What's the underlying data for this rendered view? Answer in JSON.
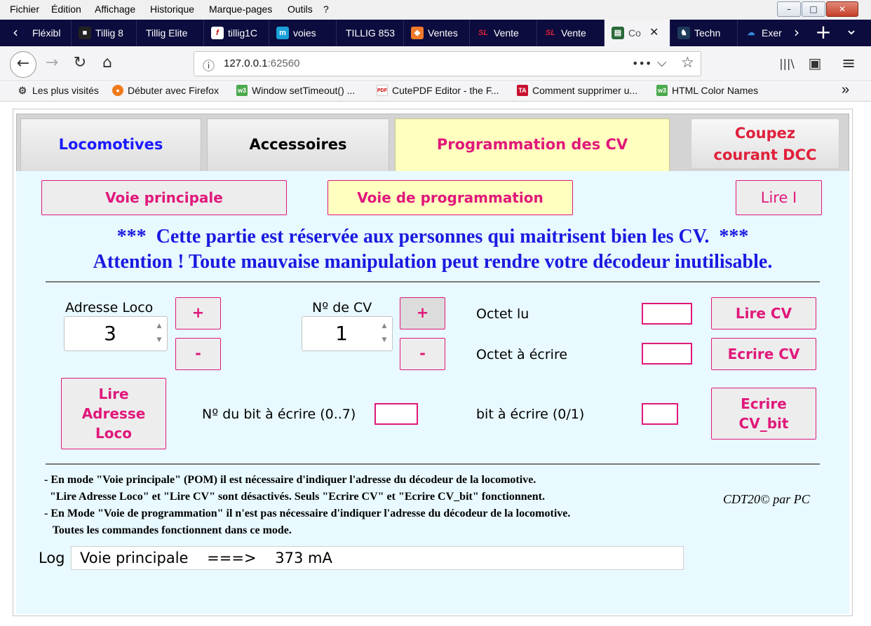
{
  "menubar": {
    "items": [
      {
        "label": "Fichier"
      },
      {
        "label": "Édition"
      },
      {
        "label": "Affichage"
      },
      {
        "label": "Historique"
      },
      {
        "label": "Marque-pages"
      },
      {
        "label": "Outils"
      },
      {
        "label": "?"
      }
    ]
  },
  "window_controls": {
    "minimize": "–",
    "maximize": "□",
    "close": "✕"
  },
  "tabs": [
    {
      "label": "Fléxibl",
      "icon": "none"
    },
    {
      "label": "Tillig 8",
      "icon": "site-icon"
    },
    {
      "label": "Tillig Elite",
      "icon": "none"
    },
    {
      "label": "tillig1C",
      "icon": "f-icon"
    },
    {
      "label": "voies",
      "icon": "m-icon"
    },
    {
      "label": "TILLIG 853",
      "icon": "none"
    },
    {
      "label": "Ventes",
      "icon": "box-icon"
    },
    {
      "label": "Vente",
      "icon": "sl-icon"
    },
    {
      "label": "Vente",
      "icon": "sl-icon"
    },
    {
      "label": "Co",
      "icon": "train-icon",
      "close": "✕"
    },
    {
      "label": "Techn",
      "icon": "horse-icon"
    },
    {
      "label": "Exer",
      "icon": "cloud-icon"
    }
  ],
  "tab_actions": {
    "new_tab": "+",
    "list": "⌄",
    "scroll_left": "‹",
    "scroll_right": "›"
  },
  "navbar": {
    "back": "←",
    "forward": "→",
    "reload": "↻",
    "home": "⌂",
    "url_host": "127.0.0.1",
    "url_port": ":62560",
    "info": "ⓘ",
    "more": "•••",
    "pocket": "⌵",
    "star": "☆",
    "library": "|||\\",
    "sidebar": "▣",
    "menu": "≡"
  },
  "bookmarks": [
    {
      "label": "Les plus visités",
      "icon": "gear-icon"
    },
    {
      "label": "Débuter avec Firefox",
      "icon": "firefox-icon"
    },
    {
      "label": "Window setTimeout() ...",
      "icon": "w3-icon"
    },
    {
      "label": "CutePDF Editor - the F...",
      "icon": "pdf-icon"
    },
    {
      "label": "Comment supprimer u...",
      "icon": "ta-icon"
    },
    {
      "label": "HTML Color Names",
      "icon": "w3-icon"
    }
  ],
  "bookmarks_overflow": "»",
  "app": {
    "tabs": {
      "locomotives": "Locomotives",
      "accessoires": "Accessoires",
      "programmation": "Programmation des CV"
    },
    "cut_button": {
      "line1": "Coupez",
      "line2": "courant DCC"
    },
    "mode_main": "Voie principale",
    "mode_prog": "Voie de programmation",
    "read_current": "Lire I",
    "warning_line1": "***  Cette partie est réservée aux personnes qui maitrisent bien les CV.  ***",
    "warning_line2": "Attention ! Toute mauvaise manipulation peut rendre votre décodeur inutilisable.",
    "address_label": "Adresse Loco",
    "address_value": "3",
    "cv_label": "Nº de CV",
    "cv_value": "1",
    "plus": "+",
    "minus": "-",
    "octet_read_label": "Octet lu",
    "octet_write_label": "Octet à écrire",
    "read_cv": "Lire CV",
    "write_cv": "Ecrire CV",
    "read_address": {
      "line1": "Lire",
      "line2": "Adresse",
      "line3": "Loco"
    },
    "bit_number_label": "Nº du bit à écrire (0..7)",
    "bit_value_label": "bit à écrire (0/1)",
    "write_cv_bit": {
      "line1": "Ecrire",
      "line2": "CV_bit"
    },
    "notes": [
      "- En mode \"Voie principale\" (POM) il est nécessaire d'indiquer l'adresse du décodeur de la locomotive.",
      "  \"Lire Adresse Loco\" et \"Lire CV\" sont désactivés. Seuls \"Ecrire CV\" et \"Ecrire CV_bit\" fonctionnent.",
      "- En Mode \"Voie de programmation\" il n'est pas nécessaire d'indiquer l'adresse du décodeur de la locomotive.",
      "   Toutes les commandes fonctionnent dans ce mode."
    ],
    "copyright": "CDT20© par PC",
    "log_label": "Log",
    "log_text": "Voie principale    ===>    373 mA"
  },
  "colors": {
    "accent_pink": "#e0187a",
    "warning_blue": "#1a1ae0",
    "panel_bg": "#e8f9ff",
    "active_tab_bg": "#ffffc0",
    "cut_red": "#e0203a",
    "tabbar_bg": "#0c0c3e"
  }
}
